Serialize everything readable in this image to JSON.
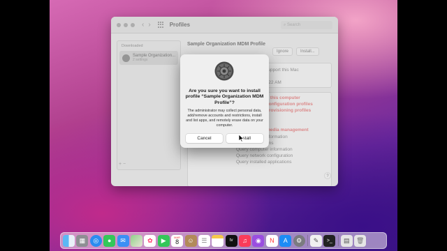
{
  "window": {
    "title": "Profiles",
    "search_placeholder": "Search",
    "sidebar_header": "Downloaded",
    "sidebar_item_name": "Sample Organization...",
    "sidebar_item_sub": "2 settings",
    "sidebar_footer": "+ −",
    "detail_title": "Sample Organization MDM Profile",
    "ignore_label": "Ignore",
    "install_label": "Install...",
    "info_lines": [
      "Support this Mac",
      "n",
      "7:22 AM"
    ],
    "warning_lines": [
      "n this computer",
      "configuration profiles",
      "provisioning profiles",
      "",
      "d",
      "media management"
    ],
    "plain_lines": [
      "nformation",
      "ons",
      "Query computer information",
      "Query network configuration",
      "Query installed applications"
    ],
    "help": "?"
  },
  "dialog": {
    "title": "Are you sure you want to install profile “Sample Organization MDM Profile”?",
    "body": "The administrator may collect personal data, add/remove accounts and restrictions, install and list apps, and remotely erase data on your computer.",
    "cancel_label": "Cancel",
    "install_label": "Install"
  },
  "dock": {
    "calendar_month": "MAR",
    "calendar_day": "8",
    "apps": [
      "finder-icon",
      "launchpad-icon",
      "safari-icon",
      "messages-icon",
      "mail-icon",
      "maps-icon",
      "photos-icon",
      "facetime-icon",
      "calendar-icon",
      "contacts-icon",
      "reminders-icon",
      "notes-icon",
      "tv-icon",
      "music-icon",
      "podcasts-icon",
      "news-icon",
      "app-store-icon",
      "system-preferences-icon",
      "textedit-icon",
      "terminal-icon",
      "preview-icon",
      "trash-icon"
    ]
  }
}
